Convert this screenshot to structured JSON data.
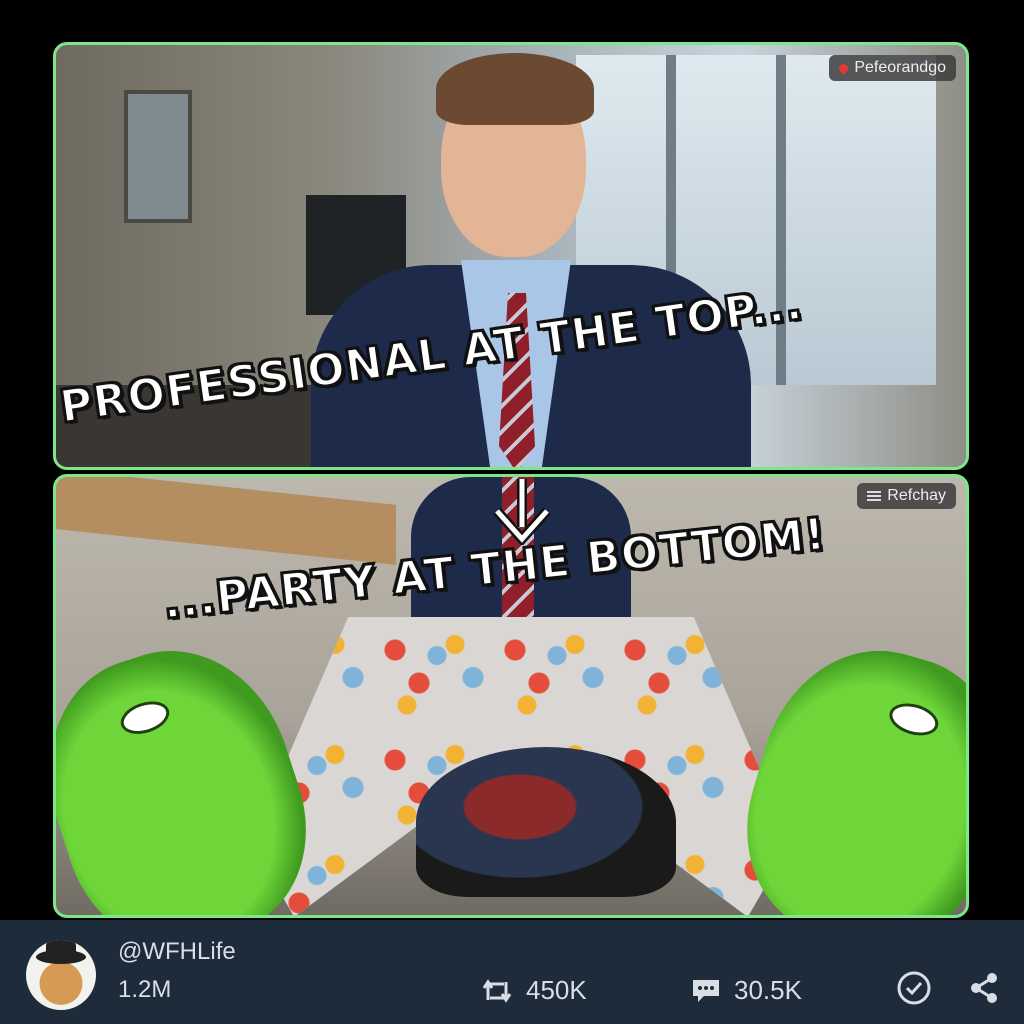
{
  "top_panel": {
    "location_tag": "Pefeorandgo"
  },
  "bottom_panel": {
    "location_tag": "Refchay"
  },
  "captions": {
    "top": "PROFESSIONAL AT THE TOP...",
    "bottom": "...PARTY AT THE BOTTOM!"
  },
  "footer": {
    "handle": "@WFHLife",
    "followers": "1.2M",
    "retweets": "450K",
    "comments": "30.5K",
    "icons": [
      "retweet-icon",
      "comment-icon",
      "check-circle-icon",
      "share-icon"
    ]
  },
  "colors": {
    "panel_border": "#7ee68a",
    "footer_bg": "#1e2b3a",
    "slipper_green": "#6fd63a"
  }
}
